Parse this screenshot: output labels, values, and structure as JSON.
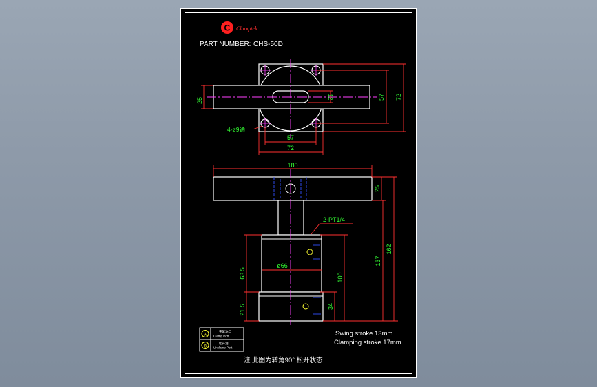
{
  "drawing": {
    "brand": "Clamptek",
    "brand_mark": "C",
    "part_number_label": "PART NUMBER:",
    "part_number": "CHS-50D",
    "notes": {
      "swing_stroke": "Swing stroke 13mm",
      "clamping_stroke": "Clamping stroke 17mm",
      "remark": "注:此图为转角90° 松开状态"
    },
    "legend": [
      {
        "symbol": "A",
        "title": "夹紧油口",
        "desc": "Clamp Port"
      },
      {
        "symbol": "B",
        "title": "松开油口",
        "desc": "Unclamp Port"
      }
    ],
    "top_view_dims": {
      "arm_height": "25",
      "slot_width": "12",
      "inner_span_v": "57",
      "outer_span_v": "72",
      "holes": "4-ø9通",
      "inner_span_h": "57",
      "outer_span_h": "72"
    },
    "front_view_dims": {
      "arm_length": "180",
      "arm_height": "25",
      "port_thread": "2-PT1/4",
      "body_diameter": "ø66",
      "upper_height": "63.5",
      "lower_height": "21.5",
      "port_to_base": "100",
      "base_port": "34",
      "body_height": "137",
      "total_height": "162"
    },
    "colors": {
      "outline": "#ffffff",
      "dimension": "#ff3030",
      "text": "#33ff33",
      "centerline": "#ff40ff",
      "hidden": "#3050ff",
      "accent": "#ffff33",
      "background": "#000000"
    }
  }
}
